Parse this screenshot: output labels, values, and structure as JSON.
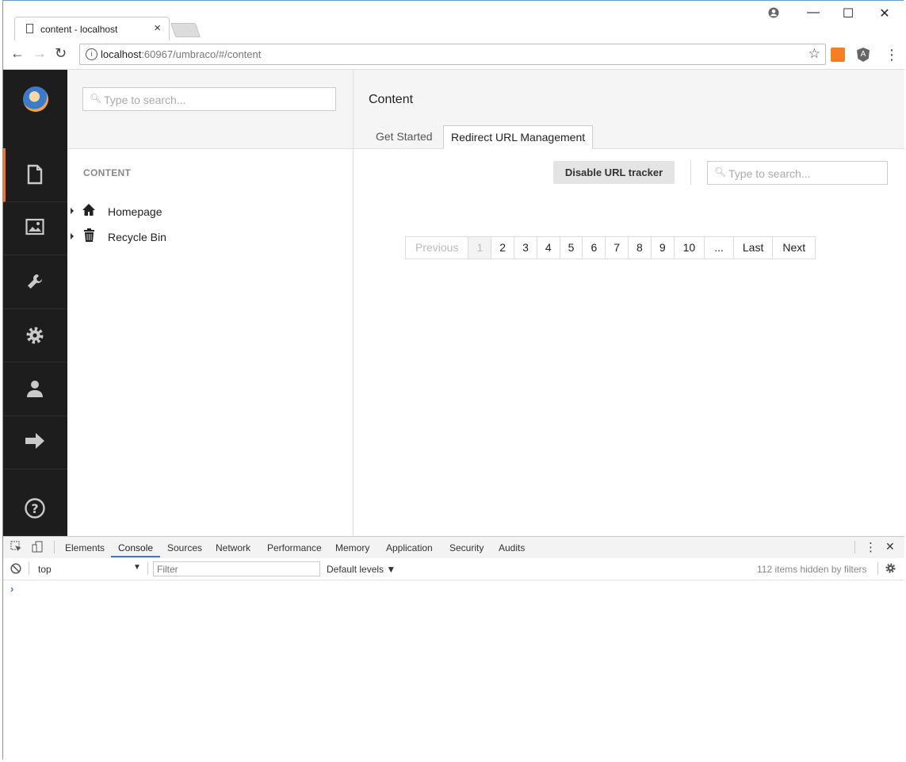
{
  "browser": {
    "tab_title": "content - localhost",
    "tab_close": "×",
    "url_host": "localhost",
    "url_rest": ":60967/umbraco/#/content",
    "window_minimize": "—",
    "window_maximize": "☐",
    "window_close": "✕"
  },
  "sections": {
    "items": [
      {
        "name": "content",
        "icon": "document-icon"
      },
      {
        "name": "media",
        "icon": "image-icon"
      },
      {
        "name": "settings",
        "icon": "wrench-icon"
      },
      {
        "name": "developer",
        "icon": "gear-icon"
      },
      {
        "name": "users",
        "icon": "user-icon"
      },
      {
        "name": "forms",
        "icon": "arrow-right-icon"
      }
    ],
    "help_icon": "help-icon"
  },
  "tree": {
    "search_placeholder": "Type to search...",
    "section_label": "CONTENT",
    "nodes": [
      {
        "label": "Homepage",
        "icon": "home-icon"
      },
      {
        "label": "Recycle Bin",
        "icon": "trash-icon"
      }
    ]
  },
  "editor": {
    "title": "Content",
    "tabs": [
      "Get Started",
      "Redirect URL Management"
    ],
    "active_tab": "Redirect URL Management",
    "disable_button": "Disable URL tracker",
    "search_placeholder": "Type to search...",
    "pagination": [
      "Previous",
      "1",
      "2",
      "3",
      "4",
      "5",
      "6",
      "7",
      "8",
      "9",
      "10",
      "...",
      "Last",
      "Next"
    ],
    "current_page": "1"
  },
  "devtools": {
    "tabs": [
      "Elements",
      "Console",
      "Sources",
      "Network",
      "Performance",
      "Memory",
      "Application",
      "Security",
      "Audits"
    ],
    "active_tab": "Console",
    "context": "top",
    "filter_placeholder": "Filter",
    "levels": "Default levels ▼",
    "hidden_count": "112 items hidden by filters",
    "prompt": "›"
  },
  "colors": {
    "accent": "#e07a43",
    "sidebar": "#1d1d1d",
    "devtools_active": "#3879d9"
  }
}
